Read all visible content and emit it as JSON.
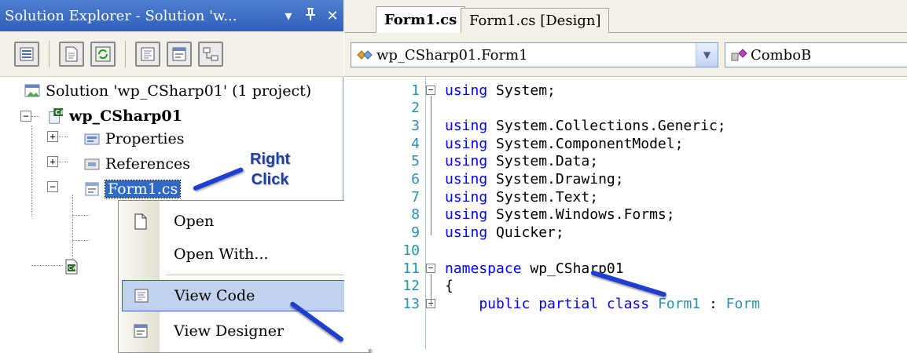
{
  "solution_explorer": {
    "title": "Solution Explorer - Solution 'w...",
    "title_buttons": [
      "▾",
      "ꟸ",
      "✕"
    ],
    "toolbar_icons": [
      "properties-icon",
      "show-all-files-icon",
      "refresh-icon",
      "view-code-icon",
      "view-designer-icon",
      "class-diagram-icon"
    ],
    "tree": {
      "solution": "Solution 'wp_CSharp01' (1 project)",
      "project": "wp_CSharp01",
      "properties": "Properties",
      "references": "References",
      "form": "Form1.cs"
    }
  },
  "context_menu": {
    "items": [
      {
        "label": "Open",
        "icon": "open-document-icon"
      },
      {
        "label": "Open With...",
        "icon": ""
      },
      {
        "label": "View Code",
        "icon": "view-code-icon"
      },
      {
        "label": "View Designer",
        "icon": "view-designer-icon"
      }
    ]
  },
  "editor": {
    "tabs": [
      "Form1.cs",
      "Form1.cs [Design]"
    ],
    "type_combo": "wp_CSharp01.Form1",
    "member_combo": "ComboB",
    "lines": [
      {
        "num": "1",
        "parts": [
          {
            "t": "using",
            "c": "kw"
          },
          {
            "t": " System;",
            "c": "pl"
          }
        ]
      },
      {
        "num": "2",
        "parts": []
      },
      {
        "num": "3",
        "parts": [
          {
            "t": "using",
            "c": "kw"
          },
          {
            "t": " System.Collections.Generic;",
            "c": "pl"
          }
        ]
      },
      {
        "num": "4",
        "parts": [
          {
            "t": "using",
            "c": "kw"
          },
          {
            "t": " System.ComponentModel;",
            "c": "pl"
          }
        ]
      },
      {
        "num": "5",
        "parts": [
          {
            "t": "using",
            "c": "kw"
          },
          {
            "t": " System.Data;",
            "c": "pl"
          }
        ]
      },
      {
        "num": "6",
        "parts": [
          {
            "t": "using",
            "c": "kw"
          },
          {
            "t": " System.Drawing;",
            "c": "pl"
          }
        ]
      },
      {
        "num": "7",
        "parts": [
          {
            "t": "using",
            "c": "kw"
          },
          {
            "t": " System.Text;",
            "c": "pl"
          }
        ]
      },
      {
        "num": "8",
        "parts": [
          {
            "t": "using",
            "c": "kw"
          },
          {
            "t": " System.Windows.Forms;",
            "c": "pl"
          }
        ]
      },
      {
        "num": "9",
        "parts": [
          {
            "t": "using",
            "c": "kw"
          },
          {
            "t": " Quicker;",
            "c": "pl"
          }
        ]
      },
      {
        "num": "10",
        "parts": []
      },
      {
        "num": "11",
        "parts": [
          {
            "t": "namespace",
            "c": "kw"
          },
          {
            "t": " wp_CSharp01",
            "c": "pl"
          }
        ]
      },
      {
        "num": "12",
        "parts": [
          {
            "t": "{",
            "c": "pl"
          }
        ]
      },
      {
        "num": "13",
        "parts": [
          {
            "t": "    public partial class ",
            "c": "kw"
          },
          {
            "t": "Form1",
            "c": "ty"
          },
          {
            "t": " : ",
            "c": "pl"
          },
          {
            "t": "Form",
            "c": "ty"
          }
        ]
      }
    ]
  },
  "annotation": {
    "right_click": "Right\nClick"
  }
}
